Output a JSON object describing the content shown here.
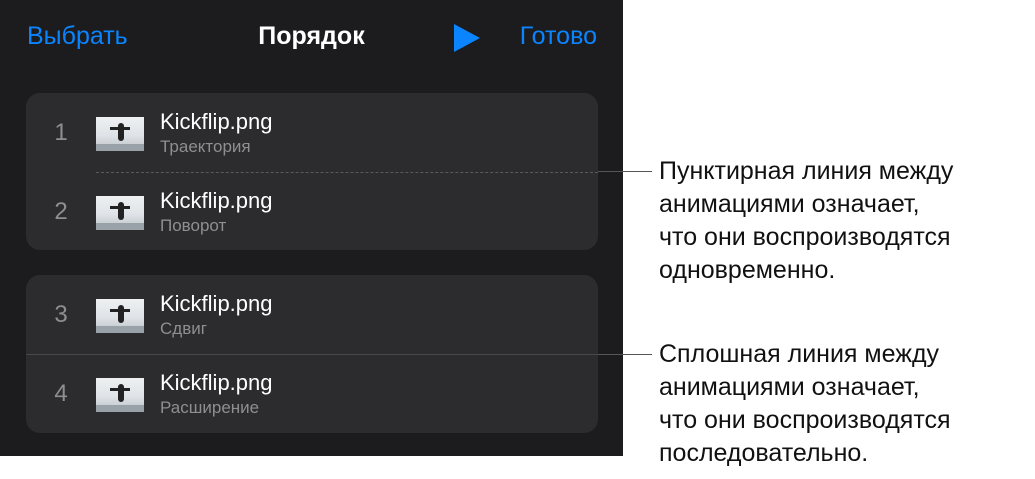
{
  "header": {
    "select_label": "Выбрать",
    "title": "Порядок",
    "play_icon": "play-icon",
    "done_label": "Готово"
  },
  "animations": [
    {
      "number": "1",
      "name": "Kickflip.png",
      "effect": "Траектория"
    },
    {
      "number": "2",
      "name": "Kickflip.png",
      "effect": "Поворот"
    },
    {
      "number": "3",
      "name": "Kickflip.png",
      "effect": "Сдвиг"
    },
    {
      "number": "4",
      "name": "Kickflip.png",
      "effect": "Расширение"
    }
  ],
  "callouts": {
    "dashed": [
      "Пунктирная линия между",
      "анимациями означает,",
      "что они воспроизводятся",
      "одновременно."
    ],
    "solid": [
      "Сплошная линия между",
      "анимациями означает,",
      "что они воспроизводятся",
      "последовательно."
    ]
  },
  "colors": {
    "accent": "#0a84ff",
    "panel_bg": "#1c1c1e",
    "row_bg": "#2c2c2e"
  }
}
